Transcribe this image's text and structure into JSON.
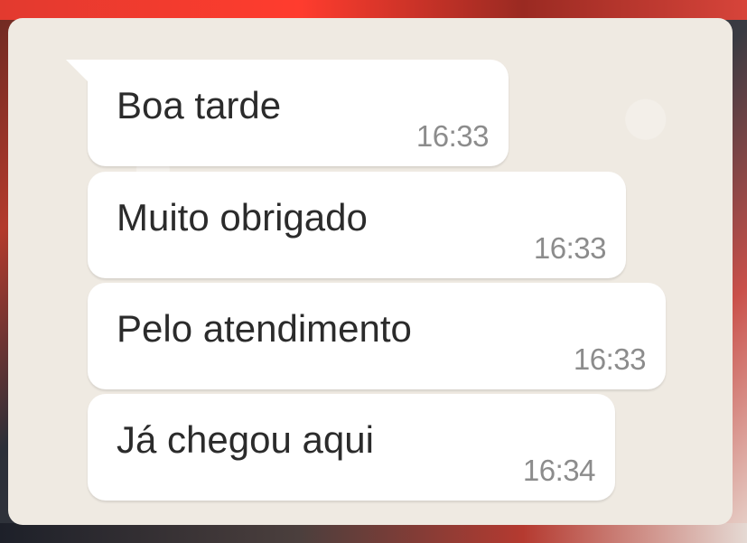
{
  "messages": [
    {
      "text": "Boa tarde",
      "time": "16:33"
    },
    {
      "text": "Muito obrigado",
      "time": "16:33"
    },
    {
      "text": "Pelo atendimento",
      "time": "16:33"
    },
    {
      "text": "Já chegou aqui",
      "time": "16:34"
    }
  ],
  "colors": {
    "chat_background": "#efeae2",
    "bubble": "#ffffff",
    "message_text": "#2b2b2b",
    "timestamp": "#8c8c8c"
  }
}
